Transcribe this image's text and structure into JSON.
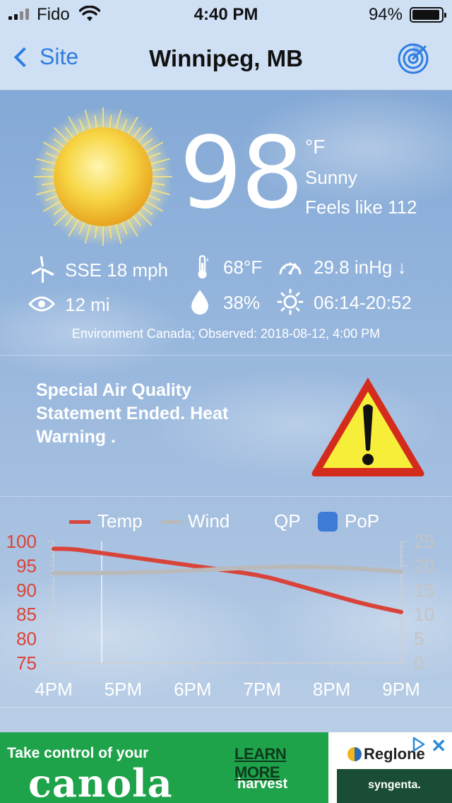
{
  "status_bar": {
    "carrier": "Fido",
    "time": "4:40 PM",
    "battery_percent": "94%",
    "battery_level": 0.94
  },
  "nav": {
    "back_label": "Site",
    "title": "Winnipeg, MB",
    "right_icon": "radar-icon"
  },
  "current": {
    "temperature": "98",
    "unit": "°F",
    "condition": "Sunny",
    "feels_like": "Feels like 112",
    "condition_icon": "sun-icon"
  },
  "details": {
    "wind": "SSE 18 mph",
    "dewpoint": "68°F",
    "pressure": "29.8 inHg ↓",
    "visibility": "12 mi",
    "humidity": "38%",
    "sunrise_sunset": "06:14-20:52"
  },
  "observed": "Environment Canada; Observed: 2018-08-12, 4:00 PM",
  "warning": {
    "text": "Special Air Quality Statement Ended. Heat Warning .",
    "icon": "warning-triangle-icon"
  },
  "chart_data": {
    "type": "line",
    "x": [
      "4PM",
      "5PM",
      "6PM",
      "7PM",
      "8PM",
      "9PM"
    ],
    "legend": [
      "Temp",
      "Wind",
      "QP",
      "PoP"
    ],
    "y_left_ticks": [
      "100",
      "95",
      "90",
      "85",
      "80",
      "75"
    ],
    "y_right_ticks": [
      "25",
      "20",
      "15",
      "10",
      "5",
      "0"
    ],
    "ylim_left": [
      75,
      100
    ],
    "ylim_right": [
      0,
      25
    ],
    "series": [
      {
        "name": "Temp",
        "axis": "left",
        "color": "#d9443a",
        "x": [
          0,
          0.25,
          0.5,
          1,
          1.5,
          2,
          2.5,
          3,
          3.5,
          4,
          4.5,
          5
        ],
        "values": [
          98.5,
          98.5,
          98,
          97,
          96,
          95,
          94,
          93,
          91,
          89,
          87,
          85.5
        ]
      },
      {
        "name": "Wind",
        "axis": "right",
        "color": "#b9b9b9",
        "x": [
          0,
          1,
          2,
          3,
          4,
          5
        ],
        "values": [
          18.5,
          18.5,
          19,
          19.8,
          19.8,
          18.8
        ]
      }
    ],
    "colors": {
      "temp": "#d9443a",
      "wind": "#b9b9b9",
      "pop": "#3e7bd6",
      "left_axis": "#d9443a",
      "right_axis": "#c4c4c4"
    }
  },
  "ad": {
    "headline": "Take control of your",
    "product": "canola",
    "harvest": "harvest",
    "cta": "LEARN MORE",
    "brand": "Reglone",
    "sponsor": "syngenta.",
    "close": "✕"
  }
}
